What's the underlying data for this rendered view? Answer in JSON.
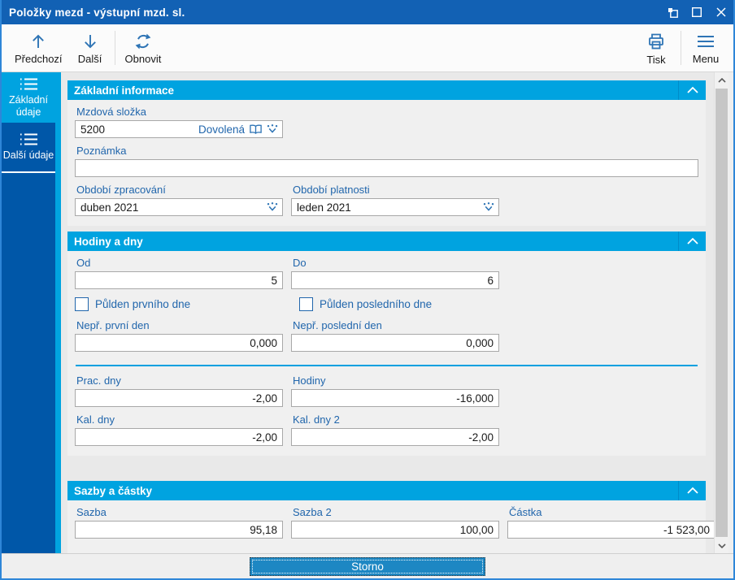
{
  "window": {
    "title": "Položky mezd - výstupní mzd. sl."
  },
  "toolbar": {
    "previous_label": "Předchozí",
    "next_label": "Další",
    "refresh_label": "Obnovit",
    "print_label": "Tisk",
    "menu_label": "Menu"
  },
  "sidebar": {
    "tabs": [
      {
        "label": "Základní údaje",
        "active": true
      },
      {
        "label": "Další údaje",
        "active": false
      }
    ]
  },
  "basic": {
    "title": "Základní informace",
    "mzdova_slozka_label": "Mzdová složka",
    "mzdova_slozka_value": "5200",
    "mzdova_slozka_name": "Dovolená",
    "poznamka_label": "Poznámka",
    "poznamka_value": "",
    "obdobi_zpracovani_label": "Období zpracování",
    "obdobi_zpracovani_value": "duben 2021",
    "obdobi_platnosti_label": "Období platnosti",
    "obdobi_platnosti_value": "leden 2021"
  },
  "hours": {
    "title": "Hodiny a dny",
    "od_label": "Od",
    "od_value": "5",
    "do_label": "Do",
    "do_value": "6",
    "pulden_prvniho_label": "Půlden prvního dne",
    "pulden_prvniho_checked": false,
    "pulden_posledniho_label": "Půlden posledního dne",
    "pulden_posledniho_checked": false,
    "nepr_prvni_label": "Nepř. první den",
    "nepr_prvni_value": "0,000",
    "nepr_posledni_label": "Nepř. poslední den",
    "nepr_posledni_value": "0,000",
    "prac_dny_label": "Prac. dny",
    "prac_dny_value": "-2,00",
    "hodiny_label": "Hodiny",
    "hodiny_value": "-16,000",
    "kal_dny_label": "Kal. dny",
    "kal_dny_value": "-2,00",
    "kal_dny2_label": "Kal. dny 2",
    "kal_dny2_value": "-2,00"
  },
  "rates": {
    "title": "Sazby a částky",
    "sazba_label": "Sazba",
    "sazba_value": "95,18",
    "sazba2_label": "Sazba 2",
    "sazba2_value": "100,00",
    "castka_label": "Částka",
    "castka_value": "-1 523,00"
  },
  "footer": {
    "storno_label": "Storno"
  },
  "colors": {
    "titlebar": "#1261b4",
    "win_border": "#2e86d8",
    "sidebar": "#0057a8",
    "accent": "#00a3e0",
    "icon": "#2e74b5",
    "label": "#2166ac",
    "btn": "#1d87c3"
  }
}
